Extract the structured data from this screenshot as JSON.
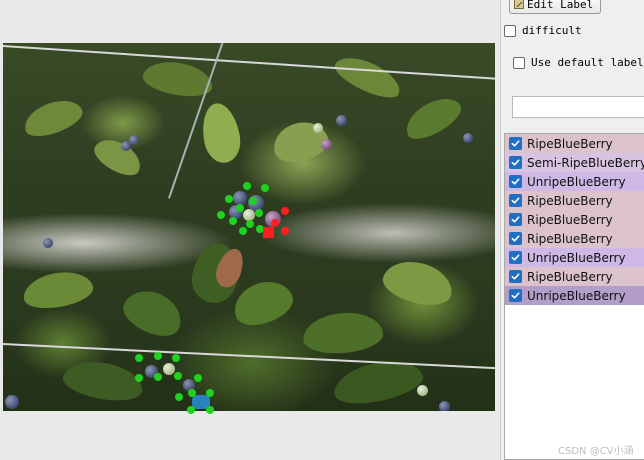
{
  "toolbar": {
    "edit_label_button": "Edit Label",
    "difficult_label": "difficult",
    "use_default_label": "Use default label",
    "default_label_value": ""
  },
  "labels": [
    {
      "text": "RipeBlueBerry",
      "checked": true,
      "bg": "#dcc3cb"
    },
    {
      "text": "Semi-RipeBlueBerry",
      "checked": true,
      "bg": "#d8c3e0"
    },
    {
      "text": "UnripeBlueBerry",
      "checked": true,
      "bg": "#cdb8e6"
    },
    {
      "text": "RipeBlueBerry",
      "checked": true,
      "bg": "#dcc3cb"
    },
    {
      "text": "RipeBlueBerry",
      "checked": true,
      "bg": "#dcc3cb"
    },
    {
      "text": "RipeBlueBerry",
      "checked": true,
      "bg": "#dcc3cb"
    },
    {
      "text": "UnripeBlueBerry",
      "checked": true,
      "bg": "#cdb8e6"
    },
    {
      "text": "RipeBlueBerry",
      "checked": true,
      "bg": "#dcc3cb"
    },
    {
      "text": "UnripeBlueBerry",
      "checked": true,
      "bg": "#b39dc9"
    }
  ],
  "watermark": "CSDN @CV小涵",
  "colors": {
    "accent": "#1f6fc5",
    "vertex_green": "#1fd21f",
    "vertex_red": "#ff1e1e",
    "selection_fill": "#2896e6"
  }
}
